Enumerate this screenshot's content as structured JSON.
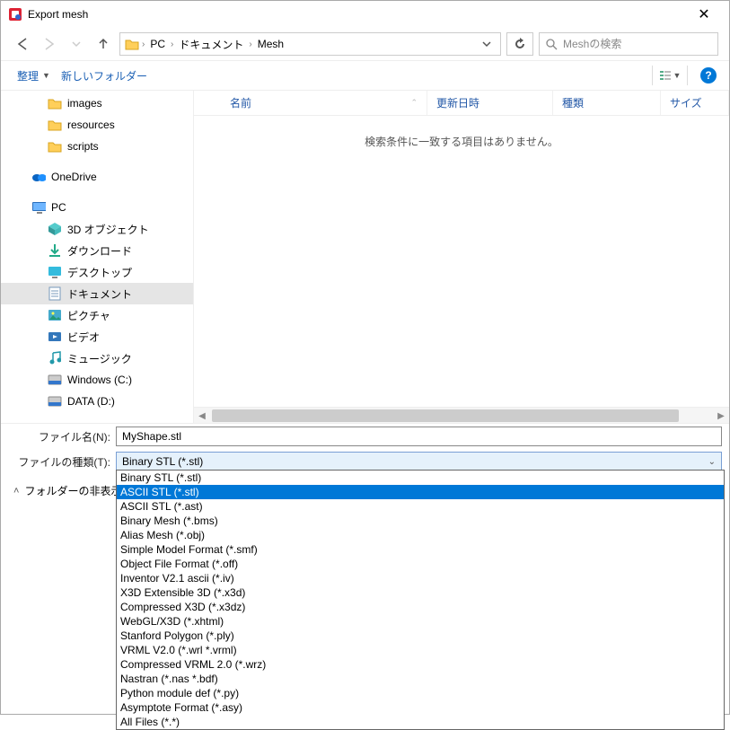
{
  "window": {
    "title": "Export mesh"
  },
  "nav": {
    "breadcrumbs": [
      "PC",
      "ドキュメント",
      "Mesh"
    ],
    "search_placeholder": "Meshの検索"
  },
  "toolbar": {
    "organize": "整理",
    "new_folder": "新しいフォルダー"
  },
  "tree": {
    "items": [
      {
        "label": "images",
        "icon": "folder",
        "deep": true
      },
      {
        "label": "resources",
        "icon": "folder",
        "deep": true
      },
      {
        "label": "scripts",
        "icon": "folder",
        "deep": true
      },
      {
        "label": "",
        "icon": "none"
      },
      {
        "label": "OneDrive",
        "icon": "onedrive"
      },
      {
        "label": "",
        "icon": "none"
      },
      {
        "label": "PC",
        "icon": "pc"
      },
      {
        "label": "3D オブジェクト",
        "icon": "cube",
        "deep": true
      },
      {
        "label": "ダウンロード",
        "icon": "download",
        "deep": true
      },
      {
        "label": "デスクトップ",
        "icon": "desktop",
        "deep": true
      },
      {
        "label": "ドキュメント",
        "icon": "doc",
        "deep": true,
        "selected": true
      },
      {
        "label": "ピクチャ",
        "icon": "pic",
        "deep": true
      },
      {
        "label": "ビデオ",
        "icon": "video",
        "deep": true
      },
      {
        "label": "ミュージック",
        "icon": "music",
        "deep": true
      },
      {
        "label": "Windows (C:)",
        "icon": "disk",
        "deep": true
      },
      {
        "label": "DATA (D:)",
        "icon": "disk",
        "deep": true
      }
    ]
  },
  "columns": {
    "name": "名前",
    "date": "更新日時",
    "kind": "種類",
    "size": "サイズ"
  },
  "empty_message": "検索条件に一致する項目はありません。",
  "form": {
    "filename_label": "ファイル名(N):",
    "filename_value": "MyShape.stl",
    "filetype_label": "ファイルの種類(T):",
    "filetype_value": "Binary STL (*.stl)",
    "hide_folders": "フォルダーの非表示"
  },
  "filetypes": [
    "Binary STL (*.stl)",
    "ASCII STL (*.stl)",
    "ASCII STL (*.ast)",
    "Binary Mesh (*.bms)",
    "Alias Mesh (*.obj)",
    "Simple Model Format (*.smf)",
    "Object File Format (*.off)",
    "Inventor V2.1 ascii (*.iv)",
    "X3D Extensible 3D (*.x3d)",
    "Compressed X3D (*.x3dz)",
    "WebGL/X3D (*.xhtml)",
    "Stanford Polygon (*.ply)",
    "VRML V2.0 (*.wrl *.vrml)",
    "Compressed VRML 2.0 (*.wrz)",
    "Nastran (*.nas *.bdf)",
    "Python module def (*.py)",
    "Asymptote Format (*.asy)",
    "All Files (*.*)"
  ],
  "filetype_selected_index": 1
}
